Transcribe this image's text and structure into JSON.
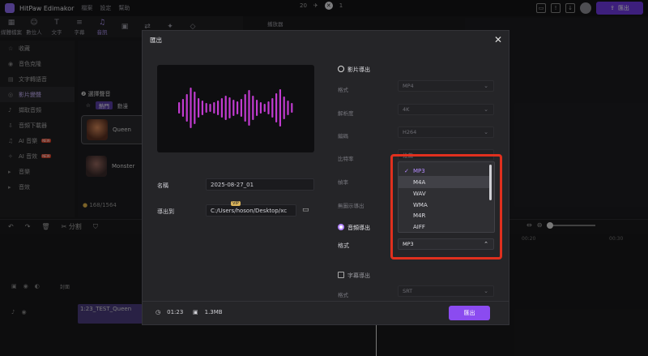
{
  "app": {
    "title": "HitPaw Edimakor",
    "menu": [
      "檔案",
      "設定",
      "幫助"
    ],
    "center_left": "20",
    "center_right": "1",
    "export_label": "匯出"
  },
  "toolbar": {
    "tabs": [
      {
        "label": "媒體檔案",
        "glyph": "▦"
      },
      {
        "label": "數位人",
        "glyph": "☺"
      },
      {
        "label": "文字",
        "glyph": "T"
      },
      {
        "label": "字幕",
        "glyph": "≡"
      },
      {
        "label": "音訊",
        "glyph": "♫"
      },
      {
        "label": "",
        "glyph": "▣"
      },
      {
        "label": "",
        "glyph": "⇄"
      },
      {
        "label": "",
        "glyph": "✦"
      },
      {
        "label": "",
        "glyph": "◇"
      }
    ]
  },
  "sidebar": {
    "items": [
      {
        "label": "收藏",
        "glyph": "☆",
        "badge": ""
      },
      {
        "label": "音色克隆",
        "glyph": "◉",
        "badge": ""
      },
      {
        "label": "文字轉語音",
        "glyph": "▤",
        "badge": ""
      },
      {
        "label": "影片變聲",
        "glyph": "◎",
        "badge": ""
      },
      {
        "label": "擷取音頻",
        "glyph": "♪",
        "badge": ""
      },
      {
        "label": "音頻下載器",
        "glyph": "⇩",
        "badge": ""
      },
      {
        "label": "AI 音樂",
        "glyph": "♫",
        "badge": "NEW"
      },
      {
        "label": "AI 音效",
        "glyph": "✧",
        "badge": "NEW"
      },
      {
        "label": "音樂",
        "glyph": "▸",
        "badge": ""
      },
      {
        "label": "音效",
        "glyph": "▸",
        "badge": ""
      }
    ]
  },
  "voices": {
    "step_title": "選擇聲音",
    "tab1": "熱門",
    "tab2": "動漫",
    "items": [
      {
        "name": "Queen"
      },
      {
        "name": "Monster"
      }
    ],
    "counter": "168/1564"
  },
  "preview_panel": {
    "title": "播放器"
  },
  "timeline": {
    "split_label": "分割",
    "cover_label": "封面",
    "clip_label": "1:23_TEST_Queen",
    "ruler": [
      "00:20",
      "00:30"
    ]
  },
  "dialog": {
    "title": "匯出",
    "name_label": "名稱",
    "name_value": "2025-08-27_01",
    "export_to_label": "導出到",
    "export_to_value": "C:/Users/hoson/Desktop/xc",
    "video_section": {
      "title": "影片導出",
      "format_label": "格式",
      "format_value": "MP4",
      "resolution_label": "解析度",
      "resolution_value": "4K",
      "codec_label": "編碼",
      "codec_value": "H264",
      "bitrate_label": "比特率",
      "bitrate_value": "推薦",
      "framerate_label": "幀率",
      "nowatermark_label": "無圖示導出",
      "vip_label": "VIP"
    },
    "audio_section": {
      "title": "音頻導出",
      "format_label": "格式",
      "format_value": "MP3",
      "options": [
        "MP3",
        "M4A",
        "WAV",
        "WMA",
        "M4R",
        "AIFF"
      ],
      "selected": "MP3",
      "hovered": "M4A"
    },
    "subtitle_section": {
      "title": "字幕導出",
      "format_label": "格式",
      "format_value": "SRT"
    },
    "footer": {
      "duration": "01:23",
      "size": "1.3MB",
      "export_button": "匯出"
    }
  },
  "colors": {
    "accent": "#8b4bf0",
    "highlight": "#e0301e",
    "waveform": "#c13bd0"
  }
}
